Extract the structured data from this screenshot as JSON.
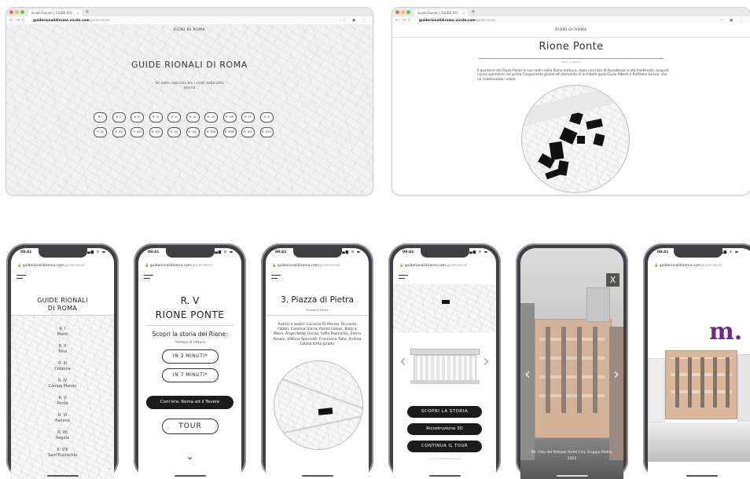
{
  "browser_common": {
    "tab_label": "Guide Rionali | GUIDE RIO",
    "tab_close": "×",
    "tab_plus": "+",
    "url_domain": "guiderionalidiroma.vicole.com",
    "url_path": "/guiderionali",
    "nav_glyphs": [
      "←",
      "→",
      "C"
    ],
    "url_icons": "☆ ● ⋮"
  },
  "browser1": {
    "site_header": "RIONI DI ROMA",
    "title": "GUIDE RIONALI DI ROMA",
    "subtitle_line1": "Se stato rosicchio tra i vicoli della città",
    "subtitle_line2": "eterna",
    "rioni_row1": [
      "R. I",
      "R. II",
      "R. III",
      "R. IV",
      "R. V",
      "R. VI",
      "R. VII",
      "R. VIII",
      "R. IX",
      "R. X"
    ],
    "rioni_row2": [
      "R. XI",
      "R. XII",
      "R. XIII",
      "R. XIV",
      "R. XV",
      "R. XVI",
      "R. XVII",
      "R. XVIII",
      "R. XIX",
      "R. XXII"
    ]
  },
  "browser2": {
    "site_header": "RIONI DI ROMA",
    "title": "Rione Ponte",
    "tiny_label": "Tempo di lettura",
    "body_text": "Il quartiere del Rione Ponte le sue radici nella Roma antica e, dopo una fase di decadenza in età medievale, acquisti nuovo splendore nel primo Cinquecento grazie all'intervento di architetti quali Giulio Alberti e Raffaello Sanzio, che ne ricostruirono i valori."
  },
  "phone_common": {
    "time": "09:41",
    "status": "▂▄▆ ≋ ▬",
    "url_domain": "guiderionalidiroma.com",
    "url_path": "/guiderionali"
  },
  "phone1": {
    "title_line1": "GUIDE RIONALI",
    "title_line2": "DI ROMA",
    "rioni": [
      {
        "num": "R. I",
        "name": "Monti"
      },
      {
        "num": "R. II",
        "name": "Trevi"
      },
      {
        "num": "R. III",
        "name": "Colonna"
      },
      {
        "num": "R. IV",
        "name": "Campo Marzio"
      },
      {
        "num": "R. V",
        "name": "Ponte"
      },
      {
        "num": "R. VI",
        "name": "Parione"
      },
      {
        "num": "R. VII",
        "name": "Regola"
      },
      {
        "num": "R. VIII",
        "name": "Sant'Eustachio"
      }
    ]
  },
  "phone2": {
    "title_line1": "R. V",
    "title_line2": "RIONE PONTE",
    "scopri": "Scopri la storia del Rione:",
    "tempo": "*tempo di lettura",
    "btn_3": "IN 3 MINUTI*",
    "btn_7": "IN 7 MINUTI*",
    "btn_dark": "Com'era: Roma ed il Tevere",
    "btn_tour": "TOUR",
    "chevron": "⌄"
  },
  "phone3": {
    "title": "3. Piazza di Pietra",
    "subtitle": "Piazza di Pietra",
    "authors": "Autrici e autori: Lucrezia Di Marzio, Riccardo Fabbri, Carolina Gloria, Renzo Llanos, Bianca Maini, Angel Nieto Garcia, Sofia Pasmanto, Zahra Rezaie, Vittoria Sperindè, Francesca Tuba, Andrea Letizia Uzho Jurado"
  },
  "phone4": {
    "btn_scopri": "SCOPRI LA STORIA",
    "btn_ricostruzione": "Ricostruzione 3D",
    "btn_continua": "CONTINUA IL TOUR",
    "footer": "A cura di Vittoria Sperindè",
    "arrow_left": "‹",
    "arrow_right": "›"
  },
  "phone5": {
    "close": "X",
    "caption_line1": "06. Foto del Palazzo Fermi Cini, Gruppo Pietra,",
    "caption_line2": "2022",
    "arrow_left": "‹",
    "arrow_right": "›"
  },
  "phone6": {
    "logo_text": "m."
  },
  "colors": {
    "dark_button": "#1c1c1c",
    "phone_frame": "#3d3f42",
    "map_bg": "#f1f1f1",
    "logo_purple": "#6a2a8a"
  }
}
